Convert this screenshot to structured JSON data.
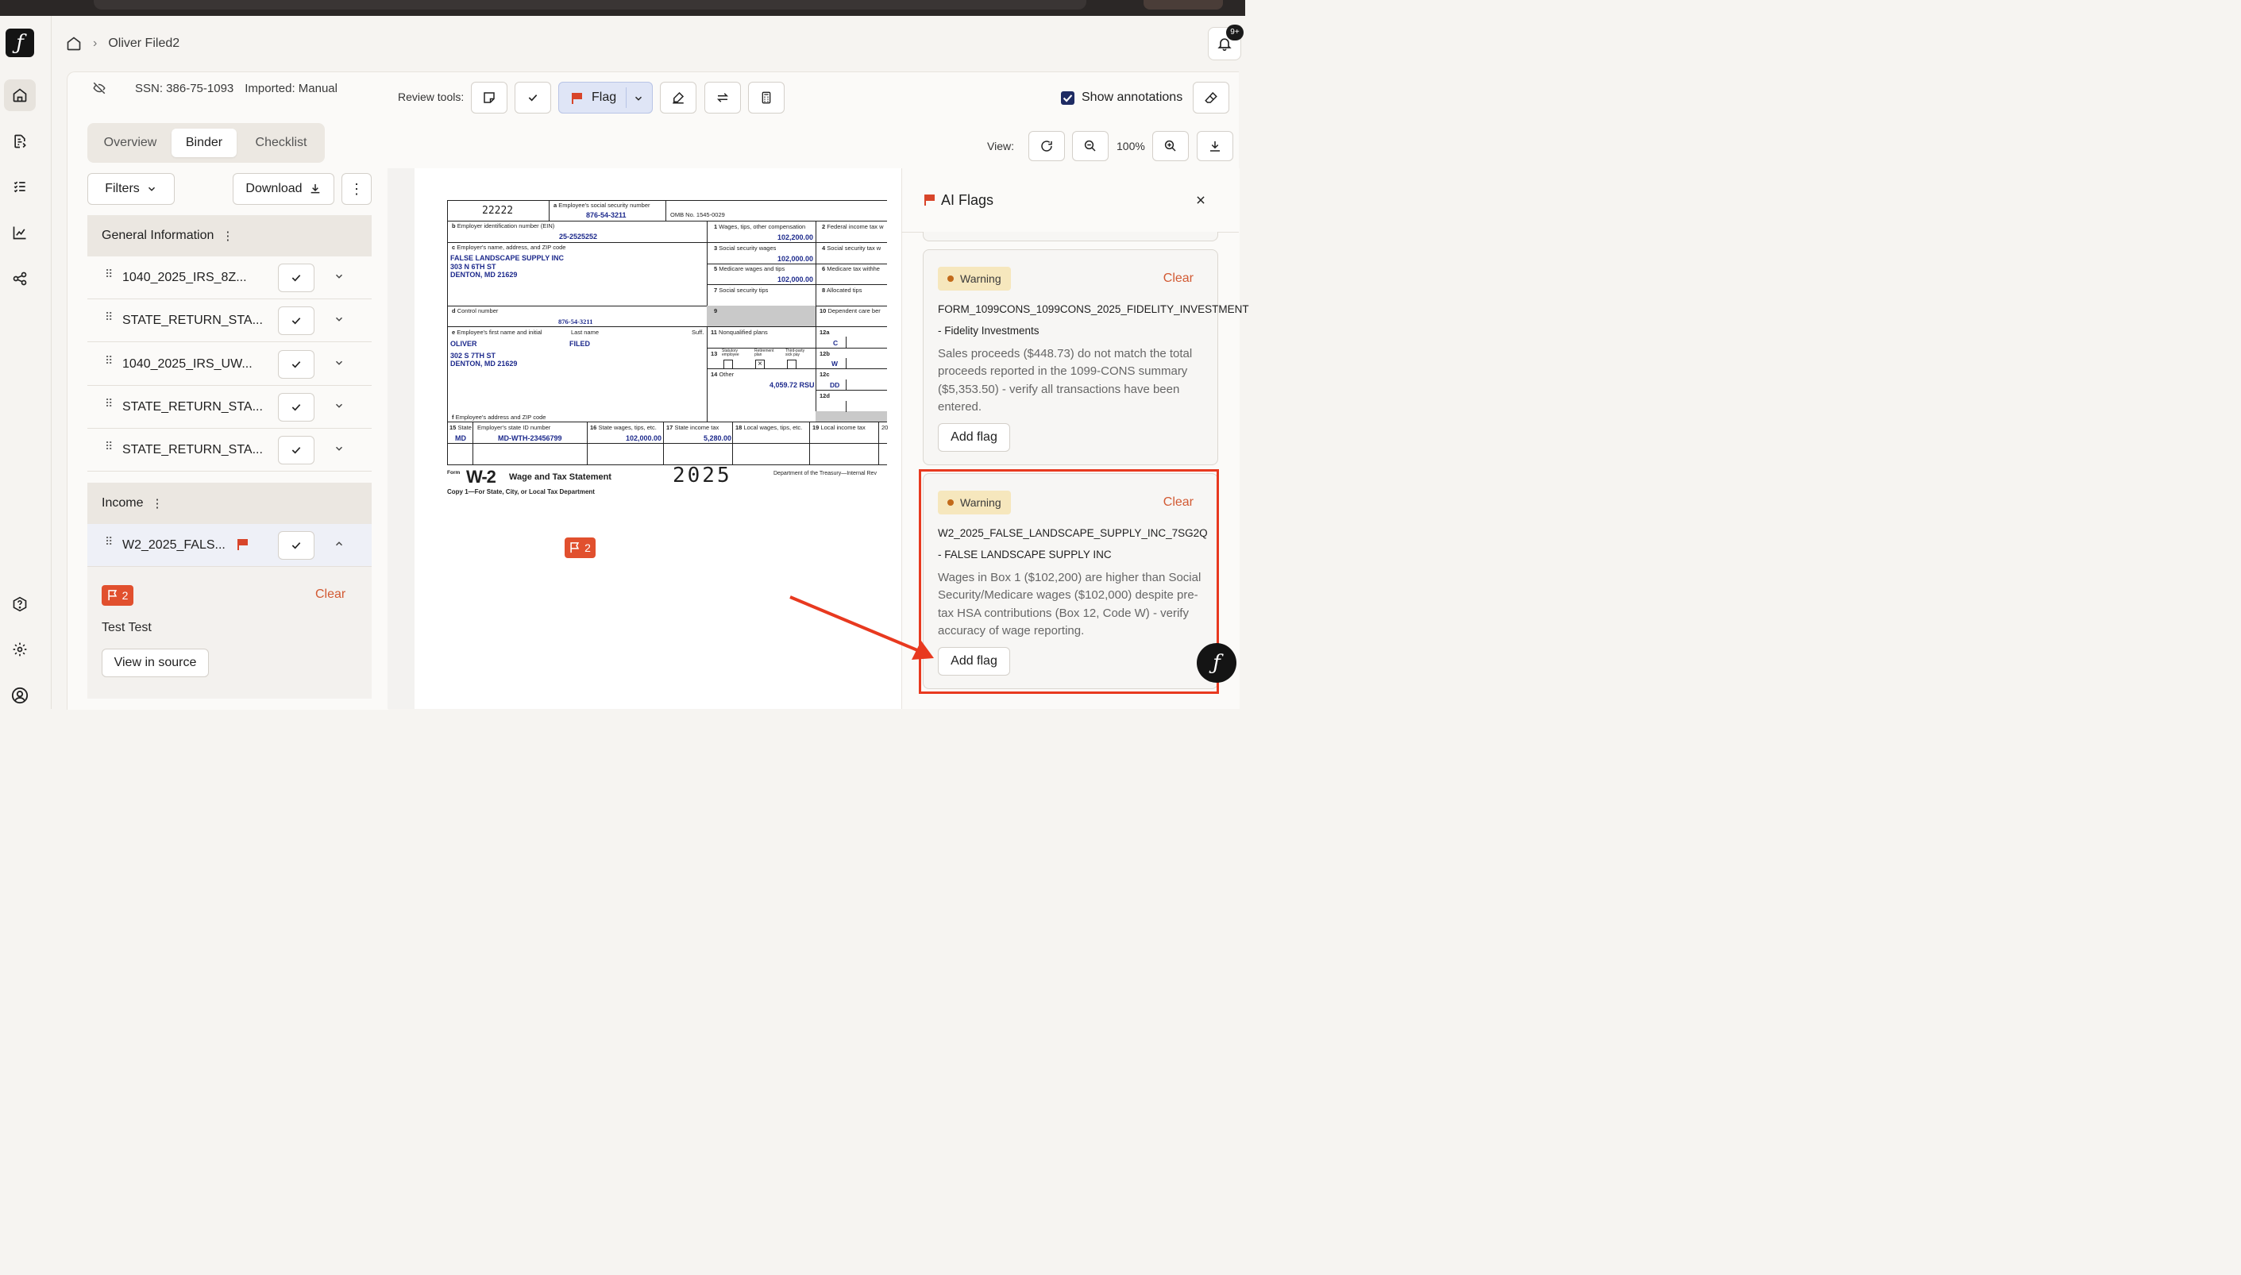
{
  "breadcrumb": {
    "client": "Oliver Filed2"
  },
  "notifications": {
    "badge": "9+"
  },
  "client_info": {
    "ssn": "SSN: 386-75-1093",
    "imported": "Imported: Manual"
  },
  "tabs": [
    "Overview",
    "Binder",
    "Checklist"
  ],
  "left_toolbar": {
    "filters": "Filters",
    "download": "Download"
  },
  "sections": {
    "general": "General Information",
    "income": "Income"
  },
  "general_rows": [
    "1040_2025_IRS_8Z...",
    "STATE_RETURN_STA...",
    "1040_2025_IRS_UW...",
    "STATE_RETURN_STA...",
    "STATE_RETURN_STA..."
  ],
  "income_rows": [
    "W2_2025_FALS..."
  ],
  "flag_detail": {
    "count": "2",
    "clear": "Clear",
    "note": "Test Test",
    "view_source": "View in source"
  },
  "review_tools": {
    "label": "Review tools:",
    "flag": "Flag",
    "show_annotations": "Show annotations"
  },
  "view": {
    "label": "View:",
    "zoom": "100%"
  },
  "doc_flag": {
    "count": "2"
  },
  "w2": {
    "control": "22222",
    "ssn_label": "Employee's social security number",
    "ssn": "876-54-3211",
    "omb": "OMB No. 1545-0029",
    "ein_label": "Employer identification number (EIN)",
    "ein": "25-2525252",
    "employer_label": "Employer's name, address, and ZIP code",
    "employer_name": "FALSE LANDSCAPE SUPPLY INC",
    "employer_addr1": "303 N 6TH ST",
    "employer_addr2": "DENTON, MD 21629",
    "control_label": "Control number",
    "control_value": "876-54-3211",
    "employee_first_label": "Employee's first name and initial",
    "employee_last_label": "Last name",
    "suff_label": "Suff.",
    "first": "OLIVER",
    "last": "FILED",
    "emp_addr1": "302 S 7TH ST",
    "emp_addr2": "DENTON, MD 21629",
    "emp_addr_label": "Employee's address and ZIP code",
    "box1_label": "Wages, tips, other compensation",
    "box1": "102,200.00",
    "box2_label": "Federal income tax w",
    "box3_label": "Social security wages",
    "box3": "102,000.00",
    "box4_label": "Social security tax w",
    "box5_label": "Medicare wages and tips",
    "box5": "102,000.00",
    "box6_label": "Medicare tax withhe",
    "box7_label": "Social security tips",
    "box8_label": "Allocated tips",
    "box10_label": "Dependent care ber",
    "box11_label": "Nonqualified plans",
    "box12a_code": "C",
    "box12b_code": "W",
    "box12c_code": "DD",
    "box13_statutory": "Statutory employee",
    "box13_retirement": "Retirement plan",
    "box13_thirdparty": "Third-party sick pay",
    "box14_label": "Other",
    "box14": "4,059.72 RSU",
    "box15_label": "State",
    "state_id_label": "Employer's state ID number",
    "state": "MD",
    "state_id": "MD-WTH-23456799",
    "box16_label": "State wages, tips, etc.",
    "box16": "102,000.00",
    "box17_label": "State income tax",
    "box17": "5,280.00",
    "box18_label": "Local wages, tips, etc.",
    "box19_label": "Local income tax",
    "box20_label": "20",
    "form_word": "Form",
    "form_name": "W-2",
    "form_title": "Wage and Tax Statement",
    "year": "2025",
    "copy": "Copy 1—For State, City, or Local Tax Department",
    "dept": "Department of the Treasury—Internal Rev"
  },
  "ai_flags": {
    "title": "AI Flags",
    "cards": [
      {
        "status": "Warning",
        "clear": "Clear",
        "doc": "FORM_1099CONS_1099CONS_2025_FIDELITY_INVESTMENT",
        "source": "- Fidelity Investments",
        "text": "Sales proceeds ($448.73) do not match the total proceeds reported in the 1099-CONS summary ($5,353.50) - verify all transactions have been entered.",
        "action": "Add flag"
      },
      {
        "status": "Warning",
        "clear": "Clear",
        "doc": "W2_2025_FALSE_LANDSCAPE_SUPPLY_INC_7SG2Q",
        "source": "- FALSE LANDSCAPE SUPPLY INC",
        "text": "Wages in Box 1 ($102,200) are higher than Social Security/Medicare wages ($102,000) despite pre-tax HSA contributions (Box 12, Code W) - verify accuracy of wage reporting.",
        "action": "Add flag"
      }
    ]
  },
  "colors": {
    "accent": "#e1502e",
    "annotation_red": "#e8391f",
    "warning_bg": "#f6e7bd"
  }
}
